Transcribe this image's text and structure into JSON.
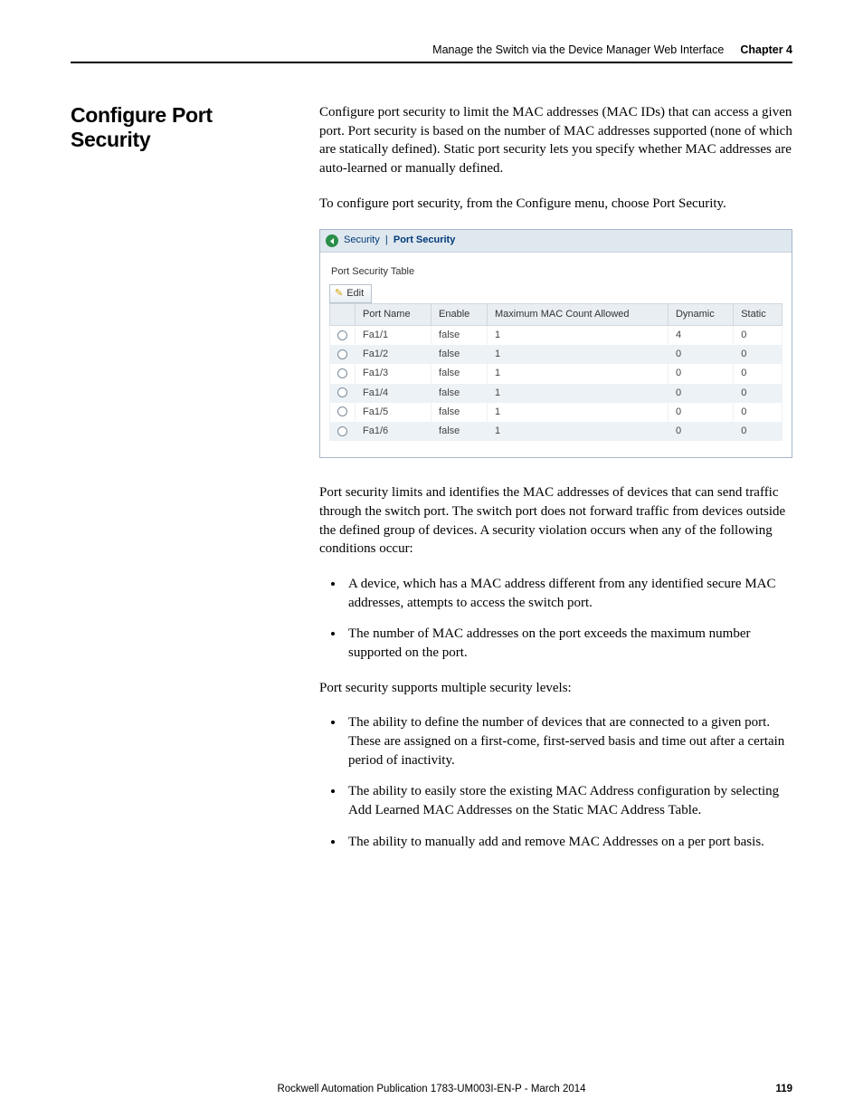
{
  "header": {
    "title": "Manage the Switch via the Device Manager Web Interface",
    "chapter": "Chapter 4"
  },
  "section_title": "Configure Port Security",
  "intro_para": "Configure port security to limit the MAC addresses (MAC IDs) that can access a given port. Port security is based on the number of MAC addresses supported (none of which are statically defined). Static port security lets you specify whether MAC addresses are auto-learned or manually defined.",
  "instruction_para": "To configure port security, from the Configure menu, choose Port Security.",
  "ui": {
    "crumb_parent": "Security",
    "crumb_sep": "|",
    "crumb_current": "Port Security",
    "table_caption": "Port Security Table",
    "edit_label": "Edit",
    "columns": [
      "",
      "Port Name",
      "Enable",
      "Maximum MAC Count Allowed",
      "Dynamic",
      "Static"
    ],
    "rows": [
      {
        "port": "Fa1/1",
        "enable": "false",
        "max": "1",
        "dyn": "4",
        "stat": "0"
      },
      {
        "port": "Fa1/2",
        "enable": "false",
        "max": "1",
        "dyn": "0",
        "stat": "0"
      },
      {
        "port": "Fa1/3",
        "enable": "false",
        "max": "1",
        "dyn": "0",
        "stat": "0"
      },
      {
        "port": "Fa1/4",
        "enable": "false",
        "max": "1",
        "dyn": "0",
        "stat": "0"
      },
      {
        "port": "Fa1/5",
        "enable": "false",
        "max": "1",
        "dyn": "0",
        "stat": "0"
      },
      {
        "port": "Fa1/6",
        "enable": "false",
        "max": "1",
        "dyn": "0",
        "stat": "0"
      }
    ]
  },
  "explain_para": "Port security limits and identifies the MAC addresses of devices that can send traffic through the switch port. The switch port does not forward traffic from devices outside the defined group of devices. A security violation occurs when any of the following conditions occur:",
  "violation_bullets": [
    "A device, which has a MAC address different from any identified secure MAC addresses, attempts to access the switch port.",
    "The number of MAC addresses on the port exceeds the maximum number supported on the port."
  ],
  "levels_intro": "Port security supports multiple security levels:",
  "levels_bullets": [
    "The ability to define the number of devices that are connected to a given port. These are assigned on a first-come, first-served basis and time out after a certain period of inactivity.",
    "The ability to easily store the existing MAC Address configuration by selecting Add Learned MAC Addresses on the Static MAC Address Table.",
    "The ability to manually add and remove MAC Addresses on a per port basis."
  ],
  "footer": {
    "pub": "Rockwell Automation Publication 1783-UM003I-EN-P - March 2014",
    "page": "119"
  }
}
